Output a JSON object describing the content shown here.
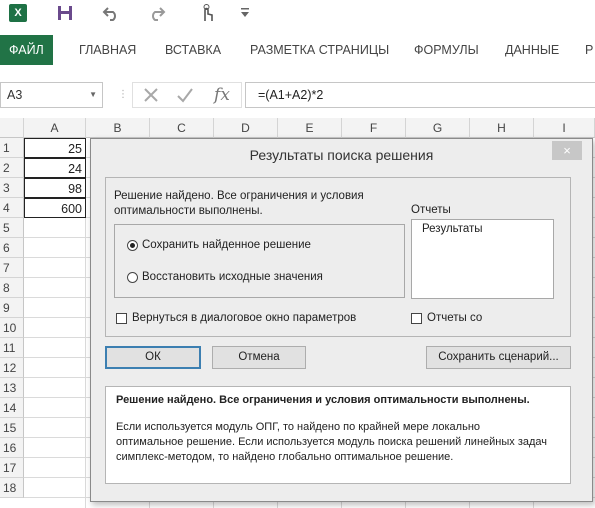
{
  "qat": {
    "app_icon": "excel-logo",
    "app_icon_text": "X",
    "icons": [
      "save-icon",
      "undo-icon",
      "redo-icon",
      "touch-mode-icon",
      "customize-qat-icon"
    ]
  },
  "ribbon": {
    "tabs": [
      "ФАЙЛ",
      "ГЛАВНАЯ",
      "ВСТАВКА",
      "РАЗМЕТКА СТРАНИЦЫ",
      "ФОРМУЛЫ",
      "ДАННЫЕ",
      "Р"
    ]
  },
  "formula_bar": {
    "name_box": "A3",
    "fx_label": "fx",
    "formula": "=(A1+A2)*2"
  },
  "sheet": {
    "columns": [
      "A",
      "B",
      "C",
      "D",
      "E",
      "F",
      "G",
      "H",
      "I"
    ],
    "rows": [
      "1",
      "2",
      "3",
      "4",
      "5",
      "6",
      "7",
      "8",
      "9",
      "10",
      "11",
      "12",
      "13",
      "14",
      "15",
      "16",
      "17",
      "18"
    ],
    "cells": {
      "A1": "25",
      "A2": "24",
      "A3": "98",
      "A4": "600"
    }
  },
  "dialog": {
    "title": "Результаты поиска решения",
    "close_label": "×",
    "message": "Решение найдено. Все ограничения и условия оптимальности выполнены.",
    "options": [
      "Сохранить найденное решение",
      "Восстановить исходные значения"
    ],
    "selected_option": "Сохранить найденное решение",
    "reports_label": "Отчеты",
    "reports": [
      "Результаты"
    ],
    "return_checkbox": "Вернуться в диалоговое окно параметров",
    "return_checked": false,
    "outline_checkbox": "Отчеты со",
    "outline_checked": false,
    "ok_label": "ОК",
    "cancel_label": "Отмена",
    "save_scenario_label": "Сохранить сценарий...",
    "info_bold": "Решение найдено. Все ограничения и условия оптимальности выполнены.",
    "info_text_1": "Если используется модуль ОПГ, то найдено по крайней мере локально",
    "info_text_2": "оптимальное решение. Если используется модуль поиска решений линейных задач",
    "info_text_3": "симплекс-методом, то найдено глобально оптимальное решение."
  },
  "colors": {
    "excel_green": "#217346",
    "dialog_bg": "#ededed"
  }
}
